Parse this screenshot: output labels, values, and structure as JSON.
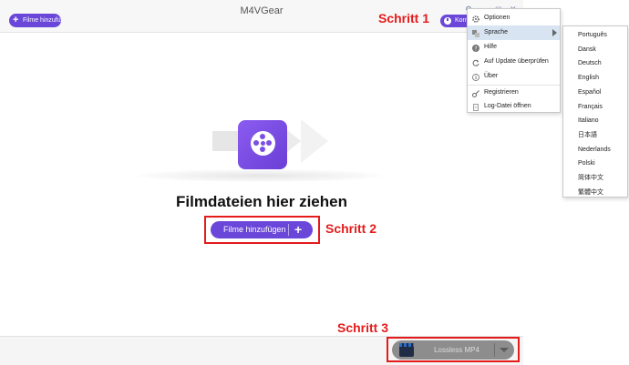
{
  "app": {
    "title": "M4VGear",
    "add_top_label": "Filme hinzufü",
    "convert_top_label": "Konv",
    "drop_title": "Filmdateien hier ziehen",
    "add_main_label": "Filme hinzufügen",
    "output_format": "Lossless MP4"
  },
  "annotations": {
    "step1": "Schritt 1",
    "step2": "Schritt 2",
    "step3": "Schritt 3",
    "color": "#e51b1b"
  },
  "window_controls": [
    "⚙",
    "—",
    "◻",
    "✕"
  ],
  "menu": {
    "items": [
      {
        "label": "Optionen",
        "icon": "gear-icon"
      },
      {
        "label": "Sprache",
        "icon": "language-icon"
      },
      {
        "label": "Hilfe",
        "icon": "help-icon"
      },
      {
        "label": "Auf Update überprüfen",
        "icon": "refresh-icon"
      },
      {
        "label": "Über",
        "icon": "info-icon"
      },
      {
        "label": "Registrieren",
        "icon": "key-icon"
      },
      {
        "label": "Log-Datei öffnen",
        "icon": "document-icon"
      }
    ]
  },
  "languages": [
    "Português",
    "Dansk",
    "Deutsch",
    "English",
    "Español",
    "Français",
    "Italiano",
    "日本語",
    "Nederlands",
    "Polski",
    "简体中文",
    "繁體中文"
  ],
  "colors": {
    "accent": "#6a47d8",
    "menu_highlight": "#d8e4f2",
    "format_button": "#8d8d8d"
  }
}
